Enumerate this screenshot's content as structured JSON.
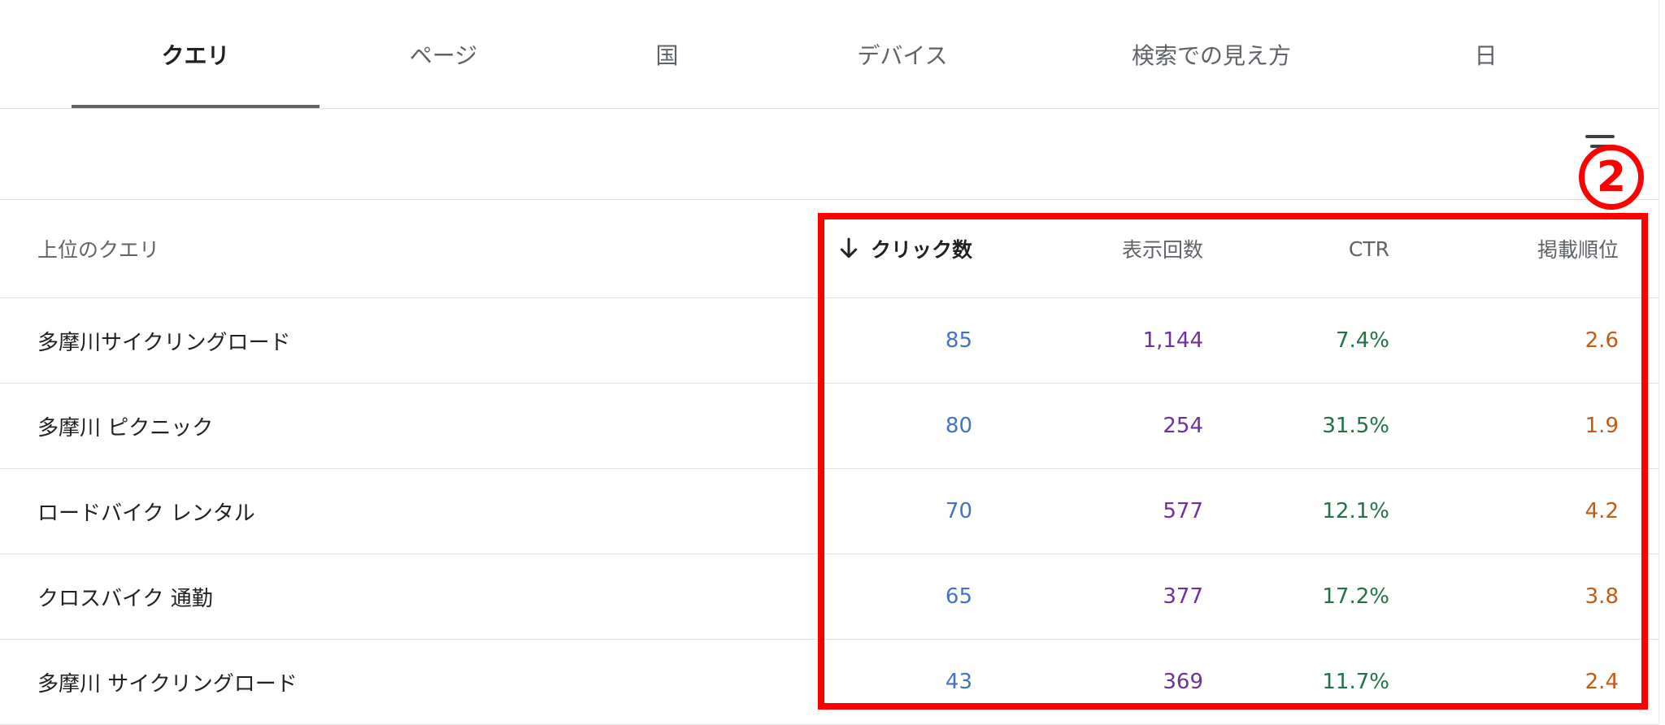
{
  "tabs": [
    {
      "label": "クエリ",
      "active": true
    },
    {
      "label": "ページ"
    },
    {
      "label": "国"
    },
    {
      "label": "デバイス"
    },
    {
      "label": "検索での見え方"
    },
    {
      "label": "日"
    }
  ],
  "filter": {
    "icon": "filter-icon"
  },
  "table": {
    "headers": {
      "query": "上位のクエリ",
      "clicks": "クリック数",
      "impressions": "表示回数",
      "ctr": "CTR",
      "position": "掲載順位"
    },
    "sort_icon": "arrow-down-icon",
    "rows": [
      {
        "query": "多摩川サイクリングロード",
        "clicks": "85",
        "impressions": "1,144",
        "ctr": "7.4%",
        "position": "2.6"
      },
      {
        "query": "多摩川 ピクニック",
        "clicks": "80",
        "impressions": "254",
        "ctr": "31.5%",
        "position": "1.9"
      },
      {
        "query": "ロードバイク レンタル",
        "clicks": "70",
        "impressions": "577",
        "ctr": "12.1%",
        "position": "4.2"
      },
      {
        "query": "クロスバイク 通勤",
        "clicks": "65",
        "impressions": "377",
        "ctr": "17.2%",
        "position": "3.8"
      },
      {
        "query": "多摩川 サイクリングロード",
        "clicks": "43",
        "impressions": "369",
        "ctr": "11.7%",
        "position": "2.4"
      }
    ]
  },
  "annotation": {
    "label": "2",
    "color": "#ff0000"
  },
  "colors": {
    "clicks": "#4472c4",
    "impressions": "#7030a0",
    "ctr": "#217346",
    "position": "#c55a11"
  }
}
